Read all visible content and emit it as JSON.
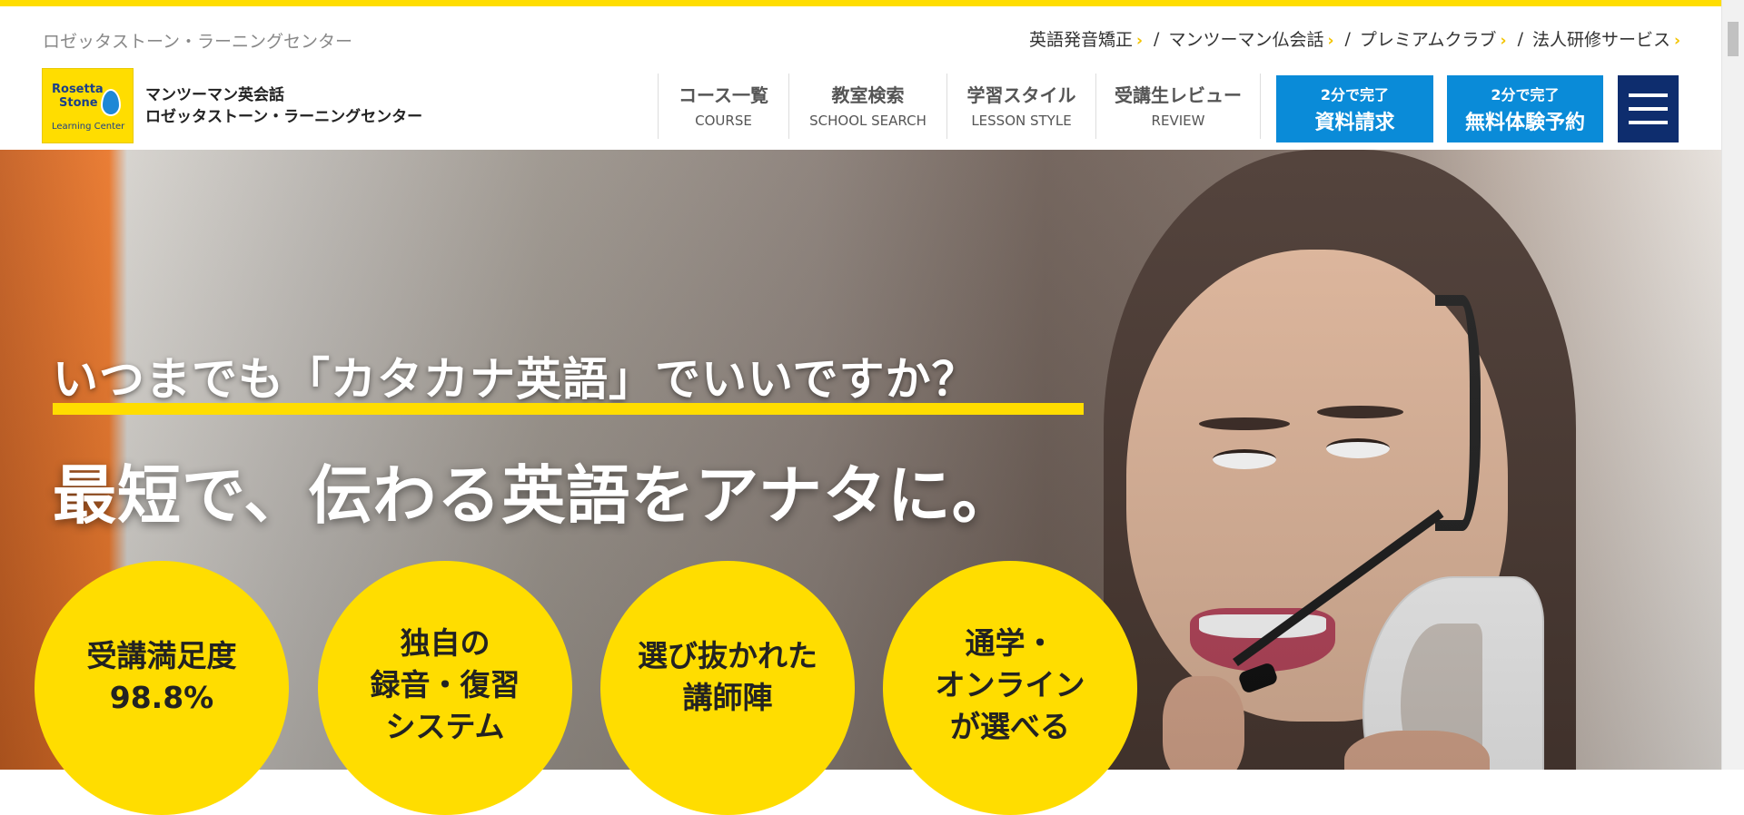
{
  "header": {
    "brand_small": "ロゼッタストーン・ラーニングセンター",
    "utility_links": [
      "英語発音矯正",
      "マンツーマン仏会話",
      "プレミアムクラブ",
      "法人研修サービス"
    ],
    "logo": {
      "line1": "Rosetta",
      "line2": "Stone",
      "line3": "Learning Center"
    },
    "company_line1": "マンツーマン英会話",
    "company_line2": "ロゼッタストーン・ラーニングセンター",
    "nav": [
      {
        "ja": "コース一覧",
        "en": "COURSE"
      },
      {
        "ja": "教室検索",
        "en": "SCHOOL SEARCH"
      },
      {
        "ja": "学習スタイル",
        "en": "LESSON STYLE"
      },
      {
        "ja": "受講生レビュー",
        "en": "REVIEW"
      }
    ],
    "cta1": {
      "small": "2分で完了",
      "big": "資料請求"
    },
    "cta2": {
      "small": "2分で完了",
      "big": "無料体験予約"
    }
  },
  "hero": {
    "headline1": "いつまでも「カタカナ英語」でいいですか？",
    "headline2": "最短で、伝わる英語をアナタに。",
    "badges": [
      [
        "受講満足度",
        "98.8%"
      ],
      [
        "独自の",
        "録音・復習",
        "システム"
      ],
      [
        "選び抜かれた",
        "講師陣"
      ],
      [
        "通学・",
        "オンライン",
        "が選べる"
      ]
    ]
  },
  "colors": {
    "accent_yellow": "#ffdd00",
    "cta_blue": "#0a8bd8",
    "menu_navy": "#0e2d6e"
  }
}
